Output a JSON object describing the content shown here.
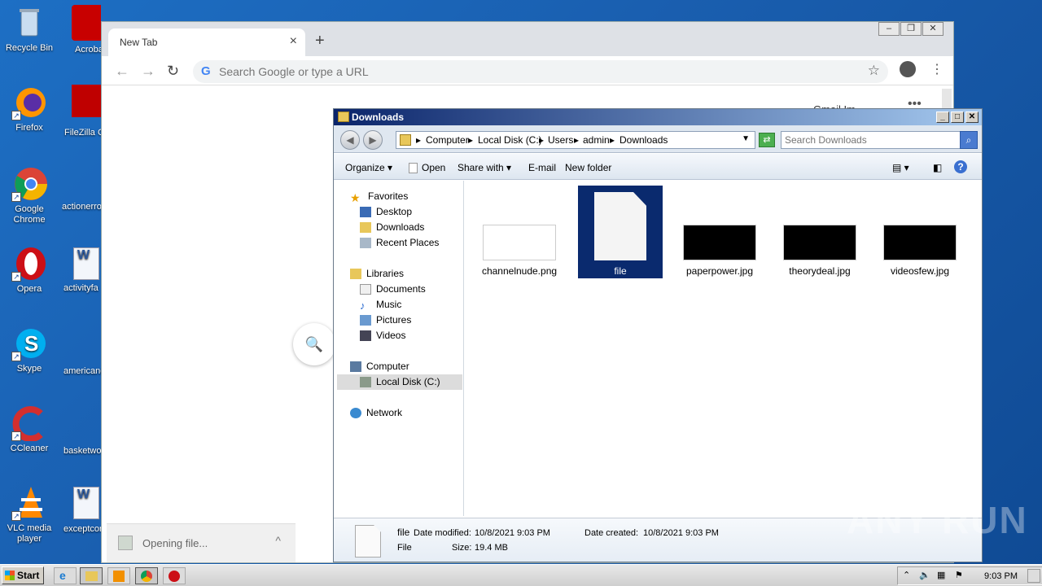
{
  "desktop": {
    "icons": [
      {
        "label": "Recycle Bin",
        "icon": "recycle-bin-icon",
        "color": "#9ec3e6"
      },
      {
        "label": "Firefox",
        "icon": "firefox-icon",
        "color": "#e66000"
      },
      {
        "label": "Google Chrome",
        "icon": "chrome-icon",
        "color": "#4285f4"
      },
      {
        "label": "Opera",
        "icon": "opera-icon",
        "color": "#cc0f16"
      },
      {
        "label": "Skype",
        "icon": "skype-icon",
        "color": "#00aff0"
      },
      {
        "label": "CCleaner",
        "icon": "ccleaner-icon",
        "color": "#d32f2f"
      },
      {
        "label": "VLC media player",
        "icon": "vlc-icon",
        "color": "#ff8800"
      }
    ],
    "icons2": [
      {
        "label": "Acrobat Reader",
        "icon": "acrobat-icon"
      },
      {
        "label": "FileZilla Cl",
        "icon": "filezilla-icon"
      },
      {
        "label": "actionerro",
        "icon": "file-icon"
      },
      {
        "label": "activityfa",
        "icon": "word-icon"
      },
      {
        "label": "americano",
        "icon": "file-icon"
      },
      {
        "label": "basketwo",
        "icon": "file-icon"
      },
      {
        "label": "exceptcor",
        "icon": "word-icon"
      }
    ]
  },
  "chrome": {
    "tab_title": "New Tab",
    "omnibox_placeholder": "Search Google or type a URL",
    "download_text": "Opening file...",
    "peek_text": "Gmail  Im",
    "dots": "•••"
  },
  "explorer": {
    "title": "Downloads",
    "breadcrumbs": [
      "Computer",
      "Local Disk (C:)",
      "Users",
      "admin",
      "Downloads"
    ],
    "search_placeholder": "Search Downloads",
    "commands": [
      "Organize",
      "Open",
      "Share with",
      "E-mail",
      "New folder"
    ],
    "nav": {
      "favorites": "Favorites",
      "favorites_items": [
        "Desktop",
        "Downloads",
        "Recent Places"
      ],
      "libraries": "Libraries",
      "libraries_items": [
        "Documents",
        "Music",
        "Pictures",
        "Videos"
      ],
      "computer": "Computer",
      "computer_items": [
        "Local Disk (C:)"
      ],
      "network": "Network"
    },
    "files": [
      {
        "name": "channelnude.png",
        "thumb": "#ffffff"
      },
      {
        "name": "file",
        "thumb": "doc"
      },
      {
        "name": "paperpower.jpg",
        "thumb": "#000000"
      },
      {
        "name": "theorydeal.jpg",
        "thumb": "#000000"
      },
      {
        "name": "videosfew.jpg",
        "thumb": "#000000"
      }
    ],
    "details": {
      "name": "file",
      "type": "File",
      "modified_label": "Date modified:",
      "modified": "10/8/2021 9:03 PM",
      "created_label": "Date created:",
      "created": "10/8/2021 9:03 PM",
      "size_label": "Size:",
      "size": "19.4 MB"
    }
  },
  "taskbar": {
    "start_label": "Start",
    "clock": "9:03 PM"
  },
  "watermark": "ANY RUN"
}
